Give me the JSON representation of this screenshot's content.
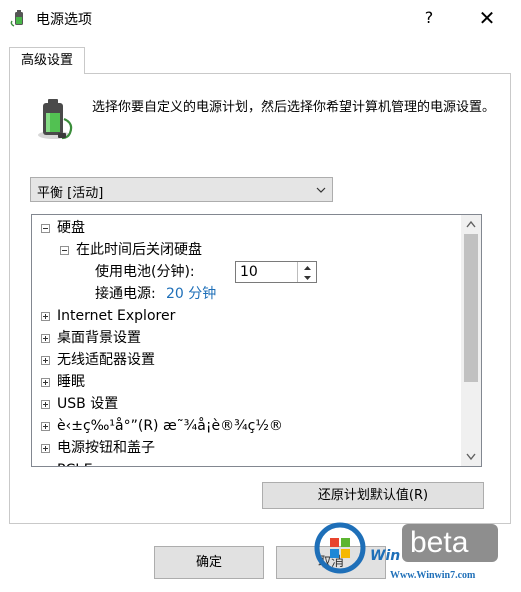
{
  "window": {
    "title": "电源选项",
    "help_label": "?",
    "close_label": "✕"
  },
  "tab": {
    "label": "高级设置"
  },
  "description": "选择你要自定义的电源计划，然后选择你希望计算机管理的电源设置。",
  "plan_select": {
    "value": "平衡 [活动]",
    "icon": "chevron-down-icon"
  },
  "tree": {
    "hard_disk": "硬盘",
    "turn_off_disk": "在此时间后关闭硬盘",
    "on_battery_label": "使用电池(分钟):",
    "on_battery_value": "10",
    "plugged_in_label": "接通电源:",
    "plugged_in_value": "20 分钟",
    "items": [
      "Internet Explorer",
      "桌面背景设置",
      "无线适配器设置",
      "睡眠",
      "USB 设置",
      "è‹±ç‰¹å°”(R) æ˜¾å¡è®¾ç½®",
      "电源按钮和盖子",
      "PCI Express"
    ]
  },
  "buttons": {
    "restore": "还原计划默认值(R)",
    "ok": "确定",
    "cancel": "取消"
  },
  "watermark": {
    "win": "Win",
    "beta": "beta",
    "url": "Www.Winwin7.com"
  },
  "colors": {
    "link": "#1e6fb8",
    "scroll_thumb": "#c1c1c1",
    "button": "#e1e1e1"
  }
}
